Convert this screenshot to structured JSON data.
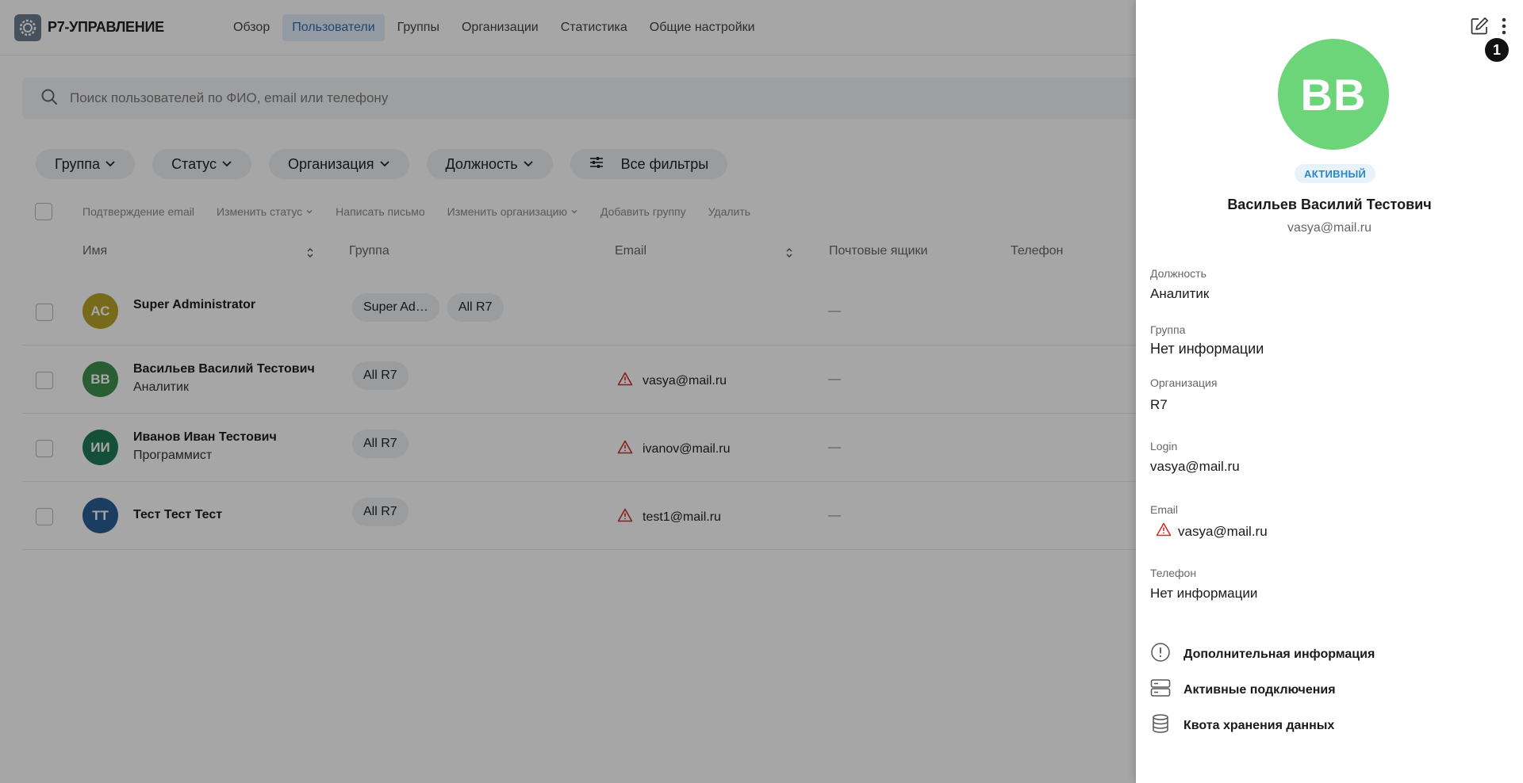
{
  "app": {
    "logo_text": "Р7-УПРАВЛЕНИЕ",
    "nav": [
      {
        "label": "Обзор"
      },
      {
        "label": "Пользователи",
        "active": true
      },
      {
        "label": "Группы"
      },
      {
        "label": "Организации"
      },
      {
        "label": "Статистика"
      },
      {
        "label": "Общие настройки"
      }
    ]
  },
  "search": {
    "placeholder": "Поиск пользователей по ФИО, email или телефону"
  },
  "filters": [
    {
      "label": "Группа"
    },
    {
      "label": "Статус"
    },
    {
      "label": "Организация"
    },
    {
      "label": "Должность"
    },
    {
      "label": "Все фильтры"
    }
  ],
  "bulk_actions": [
    {
      "label": "Подтверждение email"
    },
    {
      "label": "Изменить статус"
    },
    {
      "label": "Написать письмо"
    },
    {
      "label": "Изменить организацию"
    },
    {
      "label": "Добавить группу"
    },
    {
      "label": "Удалить"
    }
  ],
  "table": {
    "columns": {
      "name": "Имя",
      "group": "Группа",
      "email": "Email",
      "mailboxes": "Почтовые ящики",
      "phone": "Телефон"
    },
    "rows": [
      {
        "initials": "АС",
        "name": "Super Administrator",
        "position": "",
        "groups": [
          "Super Ad…",
          "All R7"
        ],
        "email": "",
        "mailboxes": "—",
        "avatar_color": "#b8a32a"
      },
      {
        "initials": "ВВ",
        "name": "Васильев Василий Тестович",
        "position": "Аналитик",
        "groups": [
          "All R7"
        ],
        "email": "vasya@mail.ru",
        "mailboxes": "—",
        "avatar_color": "#3f8f4f"
      },
      {
        "initials": "ИИ",
        "name": "Иванов Иван Тестович",
        "position": "Программист",
        "groups": [
          "All R7"
        ],
        "email": "ivanov@mail.ru",
        "mailboxes": "—",
        "avatar_color": "#1f7a58"
      },
      {
        "initials": "ТТ",
        "name": "Тест Тест Тест",
        "position": "",
        "groups": [
          "All R7"
        ],
        "email": "test1@mail.ru",
        "mailboxes": "—",
        "avatar_color": "#2a5f95"
      }
    ]
  },
  "panel": {
    "badge": "1",
    "initials": "ВВ",
    "status": "АКТИВНЫЙ",
    "name": "Васильев Василий Тестович",
    "email": "vasya@mail.ru",
    "fields": {
      "position_label": "Должность",
      "position_value": "Аналитик",
      "group_label": "Группа",
      "group_value": "Нет информации",
      "org_label": "Организация",
      "org_value": "R7",
      "login_label": "Login",
      "login_value": "vasya@mail.ru",
      "email_label": "Email",
      "email_value": "vasya@mail.ru",
      "phone_label": "Телефон",
      "phone_value": "Нет информации"
    },
    "links": {
      "extra_info": "Дополнительная информация",
      "active_connections": "Активные подключения",
      "storage_quota": "Квота хранения данных"
    }
  },
  "colors": {
    "accent": "#2f6fb3",
    "avatar_panel": "#6cd479",
    "status_text": "#2d86c6",
    "warning": "#d0312d"
  }
}
